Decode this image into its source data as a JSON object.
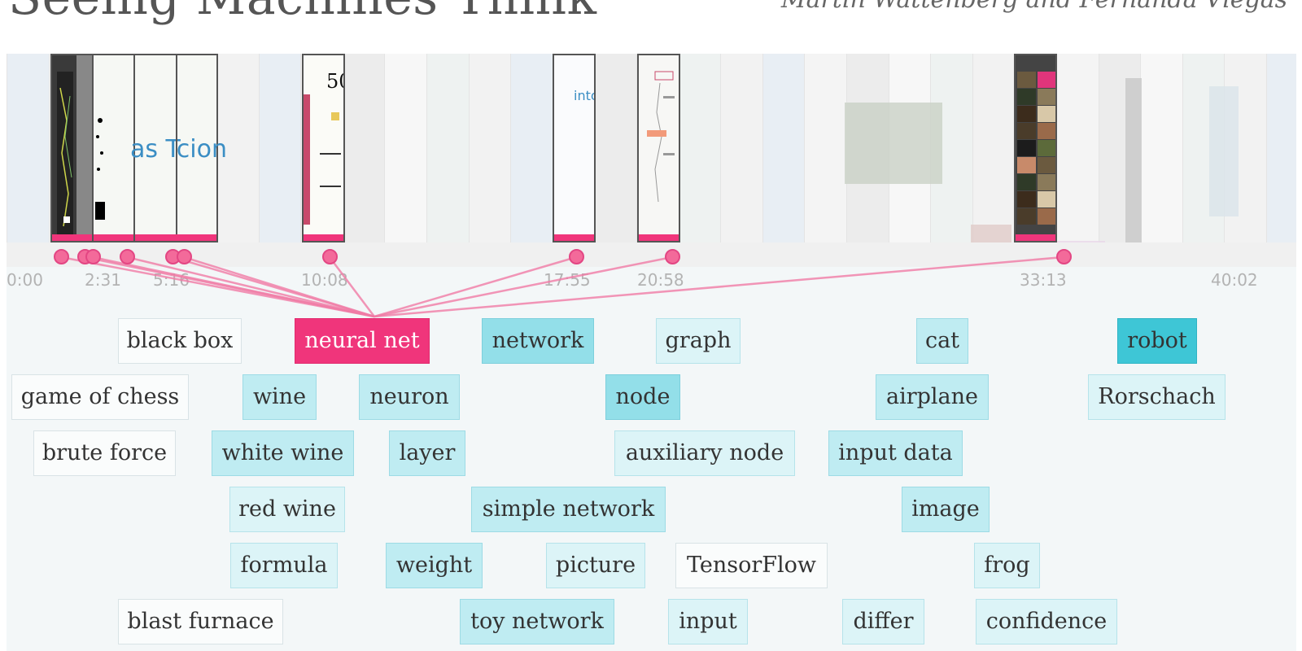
{
  "header": {
    "title": "Seeing Machines Think",
    "byline": "Martin Wattenberg and Fernanda Viégas"
  },
  "colors": {
    "accent": "#f0357b",
    "tag_strong": "#3ec6d6",
    "tag_light": "#dcf4f7"
  },
  "filmstrip": {
    "highlighted_thumbs": [
      {
        "name": "thumb-1",
        "text": ""
      },
      {
        "name": "thumb-2",
        "text": ""
      },
      {
        "name": "thumb-3",
        "text": "as Tcion"
      },
      {
        "name": "thumb-4",
        "text": ""
      },
      {
        "name": "thumb-5",
        "text": "50"
      },
      {
        "name": "thumb-6",
        "text": "into"
      },
      {
        "name": "thumb-7",
        "text": ""
      },
      {
        "name": "thumb-8",
        "text": ""
      }
    ]
  },
  "timeline": {
    "labels": [
      "0:00",
      "2:31",
      "5:16",
      "10:08",
      "17:55",
      "20:58",
      "33:13",
      "40:02"
    ]
  },
  "tags": [
    {
      "label": "black box",
      "level": 0
    },
    {
      "label": "neural net",
      "level": "selected"
    },
    {
      "label": "network",
      "level": 3
    },
    {
      "label": "graph",
      "level": 1
    },
    {
      "label": "cat",
      "level": 2
    },
    {
      "label": "robot",
      "level": 4
    },
    {
      "label": "game of chess",
      "level": 0
    },
    {
      "label": "wine",
      "level": 2
    },
    {
      "label": "neuron",
      "level": 2
    },
    {
      "label": "node",
      "level": 3
    },
    {
      "label": "airplane",
      "level": 2
    },
    {
      "label": "Rorschach",
      "level": 1
    },
    {
      "label": "brute force",
      "level": 0
    },
    {
      "label": "white wine",
      "level": 2
    },
    {
      "label": "layer",
      "level": 2
    },
    {
      "label": "auxiliary node",
      "level": 1
    },
    {
      "label": "input data",
      "level": 2
    },
    {
      "label": "red wine",
      "level": 1
    },
    {
      "label": "simple network",
      "level": 2
    },
    {
      "label": "image",
      "level": 2
    },
    {
      "label": "formula",
      "level": 1
    },
    {
      "label": "weight",
      "level": 2
    },
    {
      "label": "picture",
      "level": 1
    },
    {
      "label": "TensorFlow",
      "level": 0
    },
    {
      "label": "frog",
      "level": 1
    },
    {
      "label": "blast furnace",
      "level": 0
    },
    {
      "label": "toy network",
      "level": 2
    },
    {
      "label": "input",
      "level": 1
    },
    {
      "label": "differ",
      "level": 1
    },
    {
      "label": "confidence",
      "level": 1
    }
  ]
}
